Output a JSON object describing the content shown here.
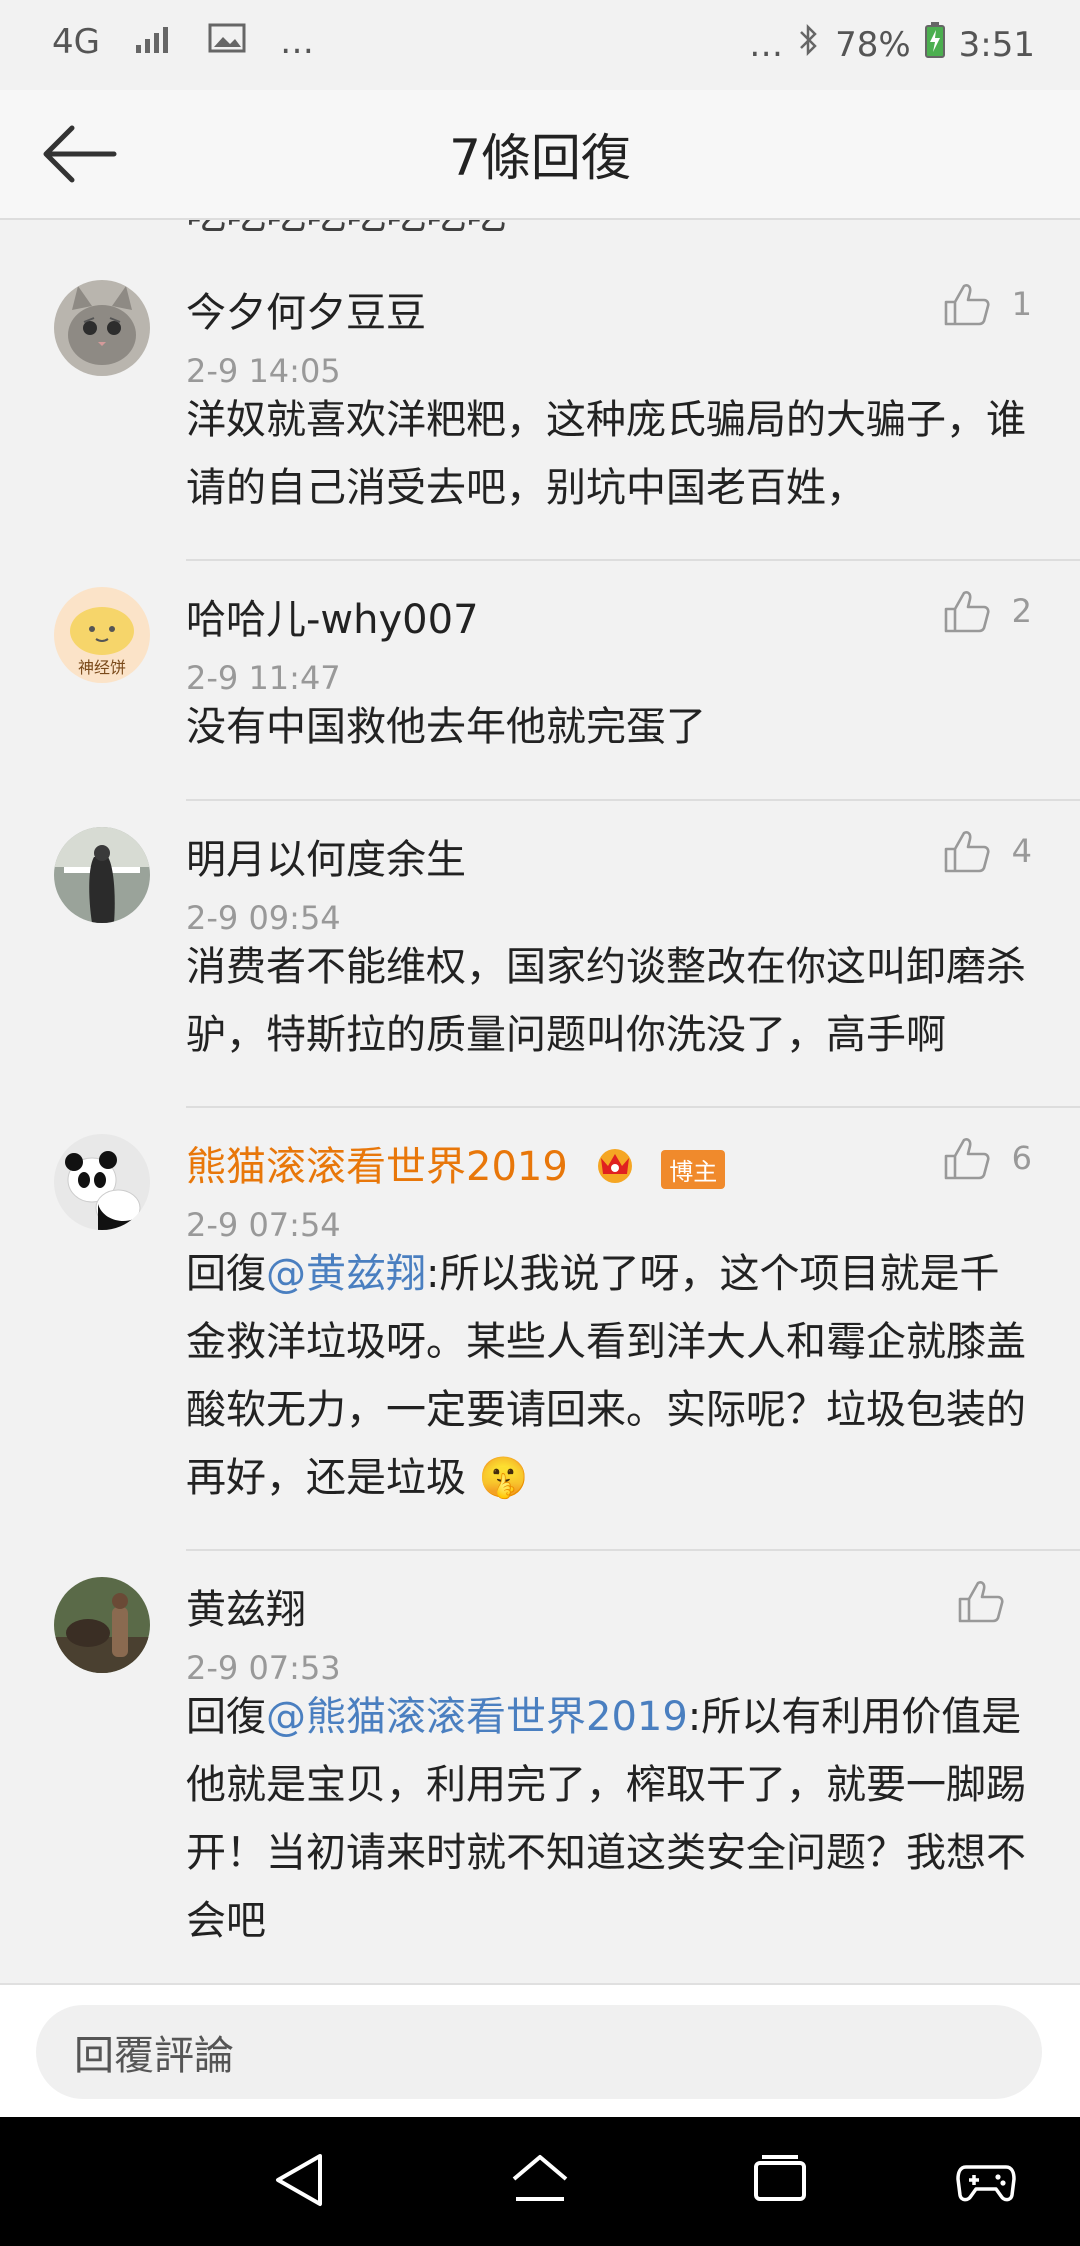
{
  "status_bar": {
    "network": "4G",
    "more": "…",
    "battery": "78%",
    "time": "3:51"
  },
  "header": {
    "title": "7條回復"
  },
  "partial_row_text": "吃吃吃吃吃吃吃吃",
  "comments": [
    {
      "username": "今夕何夕豆豆",
      "time": "2-9 14:05",
      "likes": "1",
      "body": "洋奴就喜欢洋粑粑，这种庞氏骗局的大骗子，谁请的自己消受去吧，别坑中国老百姓，"
    },
    {
      "username": "哈哈儿-why007",
      "time": "2-9 11:47",
      "likes": "2",
      "body": "没有中国救他去年他就完蛋了"
    },
    {
      "username": "明月以何度余生",
      "time": "2-9 09:54",
      "likes": "4",
      "body": "消费者不能维权，国家约谈整改在你这叫卸磨杀驴，特斯拉的质量问题叫你洗没了，高手啊"
    },
    {
      "username": "熊猫滚滚看世界2019",
      "time": "2-9 07:54",
      "likes": "6",
      "badge": "博主",
      "reply_prefix": "回復",
      "mention": "@黄兹翔",
      "body": ":所以我说了呀，这个项目就是千金救洋垃圾呀。某些人看到洋大人和霉企就膝盖酸软无力，一定要请回来。实际呢？垃圾包装的再好，还是垃圾",
      "emoji": "🤫"
    },
    {
      "username": "黄兹翔",
      "time": "2-9 07:53",
      "likes": "",
      "reply_prefix": "回復",
      "mention": "@熊猫滚滚看世界2019",
      "body": ":所以有利用价值是他就是宝贝，利用完了，榨取干了，就要一脚踢开！当初请来时就不知道这类安全问题？我想不会吧"
    }
  ],
  "reply_bar": {
    "placeholder": "回覆評論"
  },
  "colors": {
    "vip_name": "#e8770a",
    "mention": "#4a7fc0",
    "badge": "#f08a2c"
  },
  "icons": [
    "back-arrow-icon",
    "thumbs-up-icon",
    "nav-back-icon",
    "nav-home-icon",
    "nav-recents-icon",
    "gamepad-icon"
  ]
}
